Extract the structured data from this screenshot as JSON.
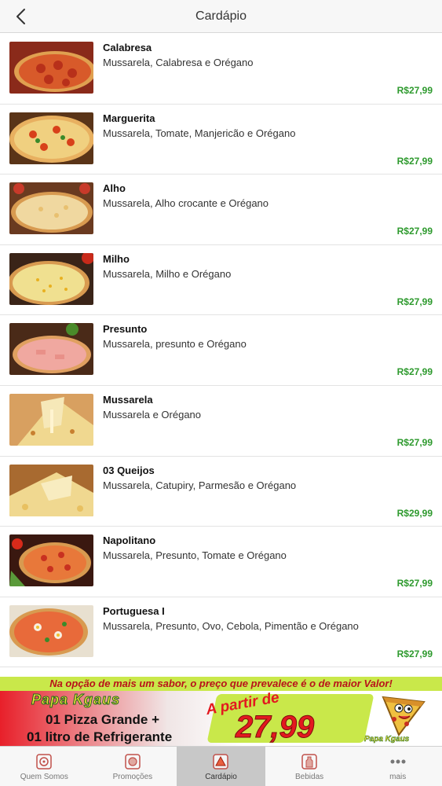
{
  "header": {
    "title": "Cardápio",
    "back_icon": "chevron-left-icon"
  },
  "menu": [
    {
      "name": "Calabresa",
      "description": "Mussarela, Calabresa e Orégano",
      "price": "R$27,99"
    },
    {
      "name": "Marguerita",
      "description": "Mussarela, Tomate, Manjericão e Orégano",
      "price": "R$27,99"
    },
    {
      "name": "Alho",
      "description": "Mussarela, Alho crocante e Orégano",
      "price": "R$27,99"
    },
    {
      "name": "Milho",
      "description": "Mussarela, Milho e Orégano",
      "price": "R$27,99"
    },
    {
      "name": "Presunto",
      "description": "Mussarela, presunto e Orégano",
      "price": "R$27,99"
    },
    {
      "name": "Mussarela",
      "description": "Mussarela e Orégano",
      "price": "R$27,99"
    },
    {
      "name": "03 Queijos",
      "description": "Mussarela, Catupiry, Parmesão e Orégano",
      "price": "R$29,99"
    },
    {
      "name": "Napolitano",
      "description": "Mussarela, Presunto, Tomate e Orégano",
      "price": "R$27,99"
    },
    {
      "name": "Portuguesa I",
      "description": "Mussarela, Presunto, Ovo, Cebola, Pimentão e Orégano",
      "price": "R$27,99"
    }
  ],
  "banner": {
    "notice": "Na opção de mais um sabor, o preço que prevalece é o de maior Valor!",
    "brand": "Papa Kgaus",
    "offer_line1": "01 Pizza Grande +",
    "offer_line2": "01 litro de Refrigerante",
    "price_prefix": "A partir de",
    "price": "27,99"
  },
  "tabs": [
    {
      "label": "Quem Somos",
      "icon": "info-circle-icon",
      "active": false
    },
    {
      "label": "Promoções",
      "icon": "promotions-icon",
      "active": false
    },
    {
      "label": "Cardápio",
      "icon": "pizza-slice-icon",
      "active": true
    },
    {
      "label": "Bebidas",
      "icon": "bottle-icon",
      "active": false
    },
    {
      "label": "mais",
      "icon": "more-dots-icon",
      "active": false
    }
  ],
  "colors": {
    "price_green": "#2e9a2e",
    "banner_red": "#e3191f",
    "banner_lime": "#c9e84a"
  }
}
